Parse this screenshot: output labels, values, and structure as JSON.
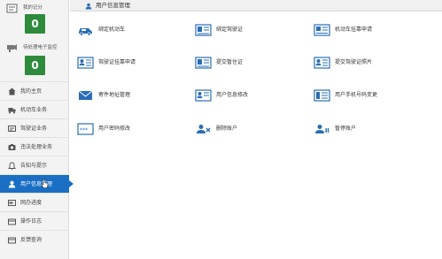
{
  "sidebar": {
    "stat1_label": "我的记分",
    "stat1_value": "0",
    "stat2_label": "待处理电子监控",
    "stat2_value": "0",
    "menu": [
      {
        "label": "我的主页",
        "icon": "home-icon"
      },
      {
        "label": "机动车业务",
        "icon": "truck-icon"
      },
      {
        "label": "驾驶证业务",
        "icon": "license-card-icon"
      },
      {
        "label": "违法处理业务",
        "icon": "camera-icon"
      },
      {
        "label": "告知与提示",
        "icon": "bell-icon"
      },
      {
        "label": "用户信息管理",
        "icon": "user-icon"
      },
      {
        "label": "网办进度",
        "icon": "progress-icon"
      },
      {
        "label": "操作日志",
        "icon": "log-icon"
      },
      {
        "label": "反馈查询",
        "icon": "feedback-icon"
      }
    ]
  },
  "header": {
    "title": "用户信息管理"
  },
  "items": [
    {
      "label": "绑定机动车",
      "icon": "car-icon"
    },
    {
      "label": "绑定驾驶证",
      "icon": "license-icon"
    },
    {
      "label": "机动车挂靠申请",
      "icon": "car-doc-icon"
    },
    {
      "label": "驾驶证挂靠申请",
      "icon": "license-doc-icon"
    },
    {
      "label": "提交暂住证",
      "icon": "id-card-icon"
    },
    {
      "label": "提交驾驶证照片",
      "icon": "photo-card-icon"
    },
    {
      "label": "寄件地址管理",
      "icon": "mail-icon"
    },
    {
      "label": "用户信息修改",
      "icon": "user-edit-icon"
    },
    {
      "label": "用户手机号码变更",
      "icon": "phone-card-icon"
    },
    {
      "label": "用户密码修改",
      "icon": "password-icon"
    },
    {
      "label": "删除账户",
      "icon": "delete-account-icon"
    },
    {
      "label": "暂停账户",
      "icon": "suspend-account-icon"
    }
  ],
  "colors": {
    "accent": "#1a6fc4",
    "count_bg": "#2e8b3c",
    "icon_blue": "#2a6db5"
  }
}
